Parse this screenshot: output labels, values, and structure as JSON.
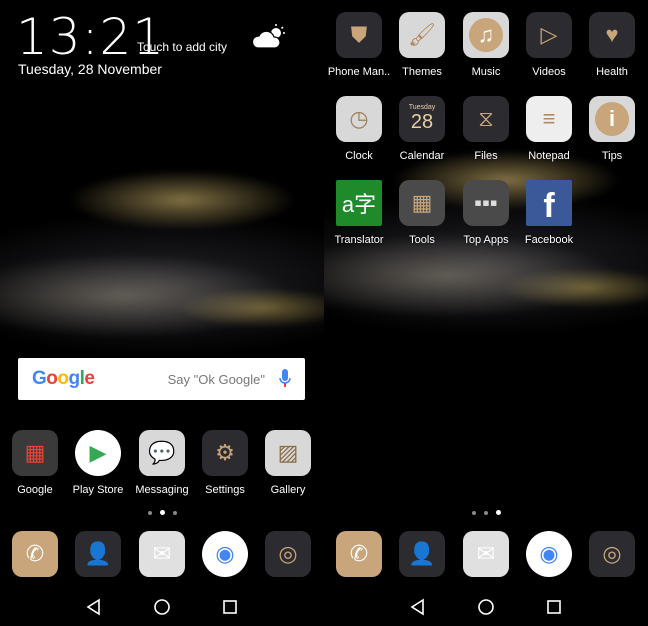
{
  "lock": {
    "time": "13:21",
    "city": "Touch to add city",
    "date": "Tuesday, 28 November",
    "weather_icon": "partly-cloudy-icon"
  },
  "search": {
    "logo": "Google",
    "placeholder": "Say \"Ok Google\"",
    "mic_icon": "mic-icon"
  },
  "home1_apps": [
    {
      "label": "Google",
      "icon": "google-folder-icon",
      "bg": "#3a3a3a",
      "glyph": "▦",
      "fg": "#ea4335"
    },
    {
      "label": "Play Store",
      "icon": "play-store-icon",
      "bg": "#ffffff",
      "glyph": "▶",
      "fg": "#34a853",
      "round": true
    },
    {
      "label": "Messaging",
      "icon": "messaging-icon",
      "bg": "#d8d8d8",
      "glyph": "💬",
      "fg": "#c8a57a"
    },
    {
      "label": "Settings",
      "icon": "settings-icon",
      "bg": "#2c2c30",
      "glyph": "⚙",
      "fg": "#c8a57a"
    },
    {
      "label": "Gallery",
      "icon": "gallery-icon",
      "bg": "#d8d8d8",
      "glyph": "▨",
      "fg": "#8a6b45"
    }
  ],
  "home2_apps": [
    {
      "label": "Phone Man..",
      "icon": "shield-icon",
      "bg": "#2c2c30",
      "glyph": "⛊",
      "fg": "#c8a57a"
    },
    {
      "label": "Themes",
      "icon": "paintbrush-icon",
      "bg": "#d8d8d8",
      "glyph": "🖌",
      "fg": "#b08a5c"
    },
    {
      "label": "Music",
      "icon": "music-note-icon",
      "bg": "#d8d8d8",
      "glyph": "♫",
      "fg": "#fff",
      "inner": "#c8a57a"
    },
    {
      "label": "Videos",
      "icon": "play-icon",
      "bg": "#2c2c30",
      "glyph": "▷",
      "fg": "#c8a57a"
    },
    {
      "label": "Health",
      "icon": "heart-icon",
      "bg": "#2c2c30",
      "glyph": "♥",
      "fg": "#c8a57a"
    },
    {
      "label": "Clock",
      "icon": "clock-icon",
      "bg": "#d8d8d8",
      "glyph": "◷",
      "fg": "#a0805a"
    },
    {
      "label": "Calendar",
      "icon": "calendar-icon",
      "bg": "#2c2c30",
      "glyph": "28",
      "fg": "#e6cfa5",
      "sub": "Tuesday"
    },
    {
      "label": "Files",
      "icon": "folder-icon",
      "bg": "#2c2c30",
      "glyph": "⧖",
      "fg": "#c8a57a"
    },
    {
      "label": "Notepad",
      "icon": "notepad-icon",
      "bg": "#eeeeee",
      "glyph": "≡",
      "fg": "#b08a5c"
    },
    {
      "label": "Tips",
      "icon": "info-icon",
      "bg": "#d8d8d8",
      "glyph": "i",
      "fg": "#fff",
      "inner": "#c8a57a"
    },
    {
      "label": "Translator",
      "icon": "translator-icon",
      "bg": "#1e8a2a",
      "glyph": "a字",
      "fg": "#fff",
      "square": true
    },
    {
      "label": "Tools",
      "icon": "tools-folder-icon",
      "bg": "#4a4a4a",
      "glyph": "▦",
      "fg": "#c8a57a"
    },
    {
      "label": "Top Apps",
      "icon": "top-apps-folder-icon",
      "bg": "#4a4a4a",
      "glyph": "▪▪▪",
      "fg": "#ddd"
    },
    {
      "label": "Facebook",
      "icon": "facebook-icon",
      "bg": "#3b5998",
      "glyph": "f",
      "fg": "#fff",
      "square": true
    }
  ],
  "dock": [
    {
      "name": "phone",
      "icon": "phone-icon",
      "bg": "#c8a57a",
      "glyph": "✆",
      "fg": "#fff"
    },
    {
      "name": "contacts",
      "icon": "contacts-icon",
      "bg": "#2c2c30",
      "glyph": "👤",
      "fg": "#c8a57a"
    },
    {
      "name": "email",
      "icon": "email-icon",
      "bg": "#e0e0e0",
      "glyph": "✉",
      "fg": "#fff"
    },
    {
      "name": "chrome",
      "icon": "chrome-icon",
      "bg": "#ffffff",
      "glyph": "◉",
      "fg": "#4285f4",
      "round": true
    },
    {
      "name": "camera",
      "icon": "camera-icon",
      "bg": "#2c2c30",
      "glyph": "◎",
      "fg": "#c8a57a"
    }
  ],
  "pages": {
    "home1_active": 1,
    "home2_active": 2,
    "count": 3
  }
}
